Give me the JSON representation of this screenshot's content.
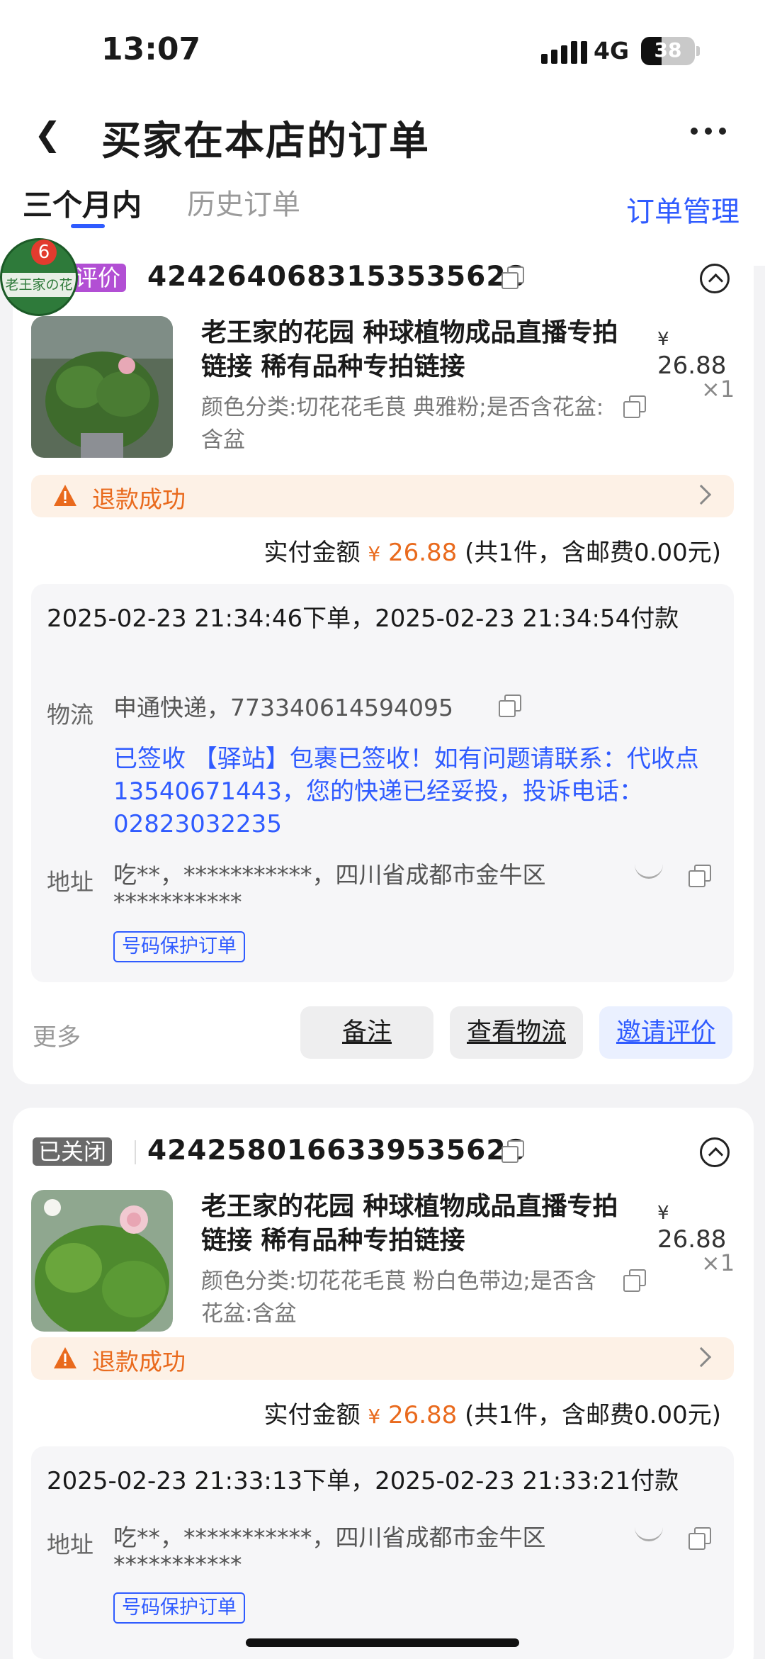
{
  "status_bar": {
    "time": "13:07",
    "network": "4G",
    "battery": "38"
  },
  "nav": {
    "title": "买家在本店的订单"
  },
  "tabs": {
    "active": "三个月内",
    "history": "历史订单",
    "manage": "订单管理"
  },
  "shop_badge": {
    "name": "老王家の花园",
    "notification_count": "6"
  },
  "orders": [
    {
      "status": "评价",
      "order_no": "4242640683153535628",
      "product_name": "老王家的花园 种球植物成品直播专拍链接 稀有品种专拍链接",
      "spec": "颜色分类:切花花毛茛 典雅粉;是否含花盆:含盆",
      "price_symbol": "¥",
      "price": "26.88",
      "qty": "×1",
      "refund_text": "退款成功",
      "paid_label": "实付金额",
      "paid_symbol": "¥",
      "paid_amount": "26.88",
      "paid_note": "(共1件，含邮费0.00元)",
      "timestamps": "2025-02-23 21:34:46下单，2025-02-23 21:34:54付款",
      "logistics_label": "物流",
      "logistics_value": "申通快递，773340614594095",
      "logistics_msg": "已签收 【驿站】包裹已签收！如有问题请联系：代收点13540671443，您的快递已经妥投，投诉电话：02823032235",
      "address_label": "地址",
      "address_value": "吃**，***********，四川省成都市金牛区",
      "address_value2": "***********",
      "protect_tag": "号码保护订单",
      "more": "更多",
      "btn_note": "备注",
      "btn_logistics": "查看物流",
      "btn_invite": "邀请评价"
    },
    {
      "status": "已关闭",
      "order_no": "4242580166339535628",
      "product_name": "老王家的花园 种球植物成品直播专拍链接 稀有品种专拍链接",
      "spec": "颜色分类:切花花毛茛 粉白色带边;是否含花盆:含盆",
      "price_symbol": "¥",
      "price": "26.88",
      "qty": "×1",
      "refund_text": "退款成功",
      "paid_label": "实付金额",
      "paid_symbol": "¥",
      "paid_amount": "26.88",
      "paid_note": "(共1件，含邮费0.00元)",
      "timestamps": "2025-02-23 21:33:13下单，2025-02-23 21:33:21付款",
      "address_label": "地址",
      "address_value": "吃**，***********，四川省成都市金牛区",
      "address_value2": "***********",
      "protect_tag": "号码保护订单"
    }
  ]
}
